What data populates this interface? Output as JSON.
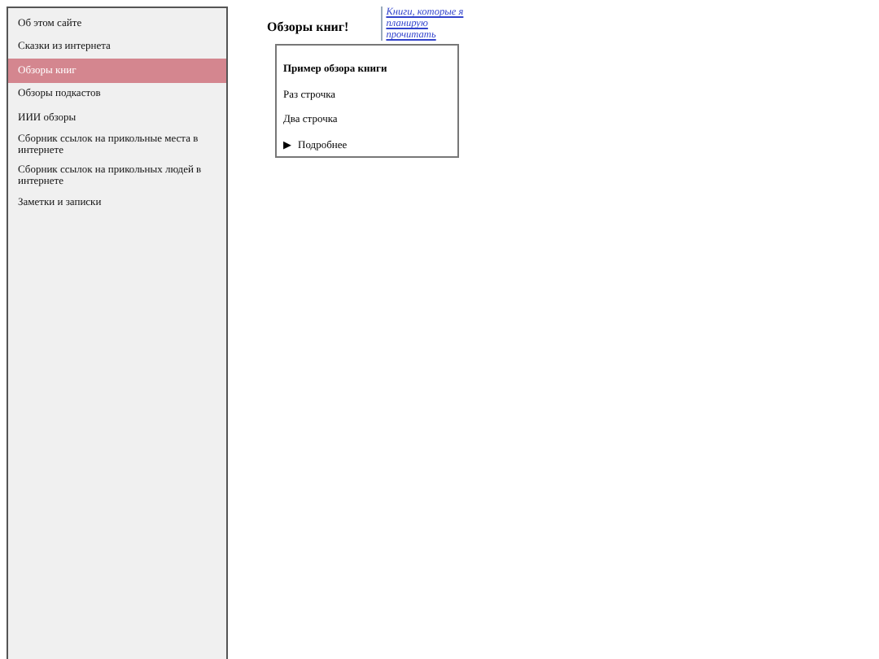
{
  "sidebar": {
    "items": [
      {
        "label": "Об этом сайте",
        "selected": false
      },
      {
        "label": "Сказки из интернета",
        "selected": false
      },
      {
        "label": "Обзоры книг",
        "selected": true
      },
      {
        "label": "Обзоры подкастов",
        "selected": false
      },
      {
        "label": "ИИИ обзоры",
        "selected": false
      },
      {
        "label": "Сборник ссылок на прикольные места в интернете",
        "selected": false
      },
      {
        "label": "Сборник ссылок на прикольных людей в интернете",
        "selected": false
      },
      {
        "label": "Заметки и записки",
        "selected": false
      }
    ]
  },
  "main": {
    "heading": "Обзоры книг!",
    "aside_link": "Книги, которые я планирую прочитать",
    "card": {
      "title": "Пример обзора книги",
      "lines": [
        "Раз строчка",
        "Два строчка"
      ],
      "details": {
        "marker": "▶",
        "summary": "Подробнее",
        "expanded": false
      }
    }
  }
}
